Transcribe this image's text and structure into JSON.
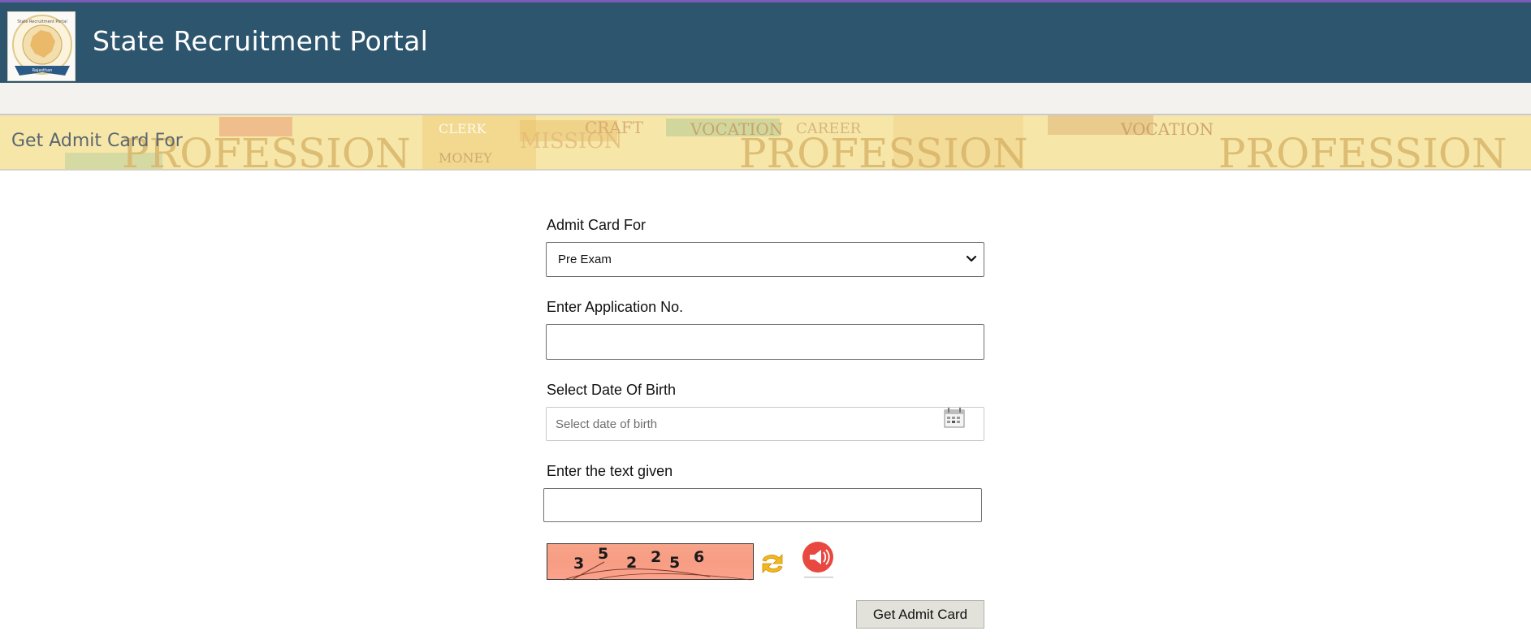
{
  "header": {
    "site_title": "State Recruitment Portal",
    "logo_icon": "state-recruitment-portal-emblem",
    "logo_text_top": "State Recruitment Portal",
    "logo_text_bottom": "Rajasthan",
    "colors": {
      "header_bg": "#2d566e",
      "top_border": "#7b5db8"
    }
  },
  "banner": {
    "page_title": "Get Admit Card For",
    "background_words": [
      "PROFESSION",
      "CLERK",
      "VOCATION",
      "MISSION",
      "MONEY",
      "CRAFT",
      "CAREER"
    ]
  },
  "form": {
    "admit_card_for": {
      "label": "Admit Card For",
      "selected": "Pre Exam",
      "icon": "chevron-down-icon"
    },
    "application_no": {
      "label": "Enter Application No.",
      "value": ""
    },
    "date_of_birth": {
      "label": "Select Date Of Birth",
      "placeholder": "Select date of birth",
      "icon": "calendar-icon"
    },
    "captcha_text": {
      "label": "Enter the text given",
      "value": ""
    },
    "captcha": {
      "digits": [
        "3",
        "5",
        "2",
        "2",
        "5",
        "6"
      ],
      "refresh_icon": "refresh-icon",
      "audio_icon": "audio-speaker-icon"
    },
    "submit_label": "Get Admit Card"
  }
}
